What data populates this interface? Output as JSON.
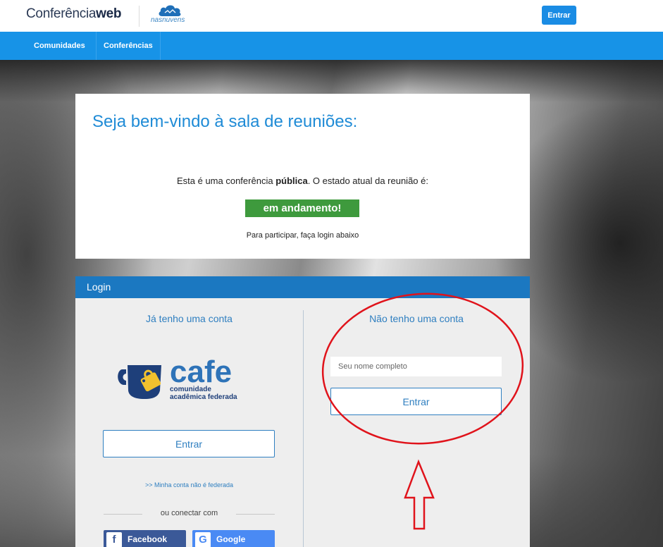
{
  "header": {
    "brand_light": "Conferência",
    "brand_bold": "web",
    "partner": "nasnuvens",
    "login_button": "Entrar"
  },
  "nav": {
    "items": [
      {
        "label": "Comunidades"
      },
      {
        "label": "Conferências"
      }
    ]
  },
  "welcome": {
    "title": "Seja bem-vindo à sala de reuniões:",
    "line_prefix": "Esta é uma conferência ",
    "line_bold": "pública",
    "line_suffix": ". O estado atual da reunião é:",
    "status": "em andamento!",
    "hint": "Para participar, faça login abaixo"
  },
  "login": {
    "header": "Login",
    "left": {
      "title": "Já tenho uma conta",
      "cafe_brand": "cafe",
      "cafe_tagline_1": "comunidade",
      "cafe_tagline_2": "acadêmica federada",
      "button": "Entrar",
      "not_federated": ">> Minha conta não é federada",
      "or_connect": "ou conectar com",
      "facebook": "Facebook",
      "google": "Google"
    },
    "right": {
      "title": "Não tenho uma conta",
      "name_placeholder": "Seu nome completo",
      "name_value": "",
      "button": "Entrar"
    }
  },
  "colors": {
    "primary": "#1793e7",
    "login_header": "#1b78c1",
    "status_green": "#3e9a3d",
    "annotation_red": "#e0131b"
  }
}
